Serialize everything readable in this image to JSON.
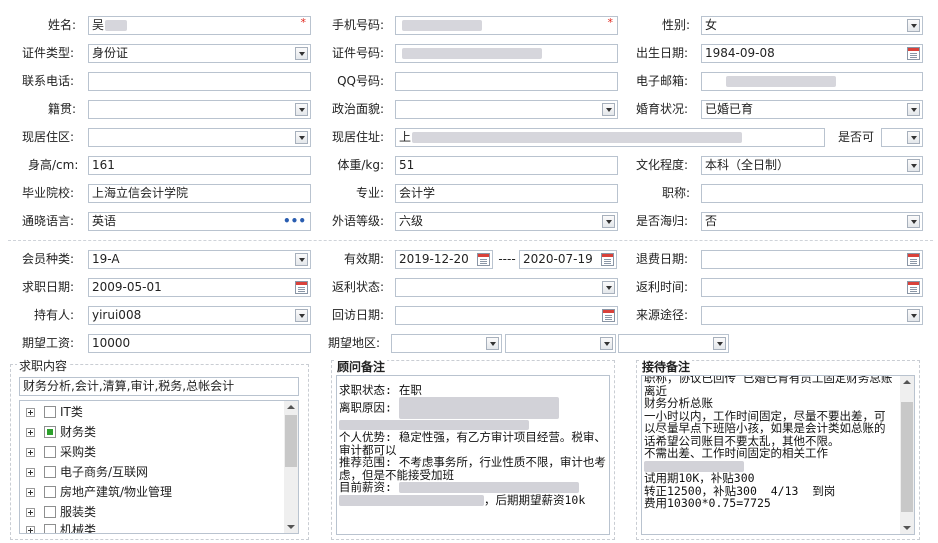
{
  "basic": {
    "name_label": "姓名:",
    "name_value": "吴",
    "required_mark": "*",
    "phone_label": "手机号码:",
    "gender_label": "性别:",
    "gender_value": "女",
    "id_type_label": "证件类型:",
    "id_type_value": "身份证",
    "id_no_label": "证件号码:",
    "birth_label": "出生日期:",
    "birth_value": "1984-09-08",
    "contact_label": "联系电话:",
    "qq_label": "QQ号码:",
    "email_label": "电子邮箱:",
    "native_label": "籍贯:",
    "political_label": "政治面貌:",
    "marital_label": "婚育状况:",
    "marital_value": "已婚已育",
    "district_label": "现居住区:",
    "address_label": "现居住址:",
    "address_value": "上",
    "ok_label": "是否可",
    "height_label": "身高/cm:",
    "height_value": "161",
    "weight_label": "体重/kg:",
    "weight_value": "51",
    "edu_label": "文化程度:",
    "edu_value": "本科（全日制）",
    "school_label": "毕业院校:",
    "school_value": "上海立信会计学院",
    "major_label": "专业:",
    "major_value": "会计学",
    "title_label": "职称:",
    "language_label": "通晓语言:",
    "language_value": "英语",
    "language_more": "•••",
    "foreign_level_label": "外语等级:",
    "foreign_level_value": "六级",
    "overseas_label": "是否海归:",
    "overseas_value": "否"
  },
  "member": {
    "type_label": "会员种类:",
    "type_value": "19-A",
    "valid_label": "有效期:",
    "valid_from": "2019-12-20",
    "valid_sep": "----",
    "valid_to": "2020-07-19",
    "refund_label": "退费日期:",
    "job_date_label": "求职日期:",
    "job_date_value": "2009-05-01",
    "rebate_status_label": "返利状态:",
    "rebate_time_label": "返利时间:",
    "holder_label": "持有人:",
    "holder_value": "yirui008",
    "revisit_label": "回访日期:",
    "source_label": "来源途径:",
    "salary_label": "期望工资:",
    "salary_value": "10000",
    "area_label": "期望地区:"
  },
  "job": {
    "title": "求职内容",
    "summary": "财务分析,会计,清算,审计,税务,总帐会计",
    "tree": [
      {
        "label": "IT类",
        "checked": false
      },
      {
        "label": "财务类",
        "checked": true
      },
      {
        "label": "采购类",
        "checked": false
      },
      {
        "label": "电子商务/互联网",
        "checked": false
      },
      {
        "label": "房地产建筑/物业管理",
        "checked": false
      },
      {
        "label": "服装类",
        "checked": false
      },
      {
        "label": "机械类",
        "checked": false
      }
    ]
  },
  "advisor": {
    "title": "顾问备注",
    "line1": "求职状态: 在职",
    "line2": "离职原因:",
    "line3": "个人优势: 稳定性强，有乙方审计项目经营。税审、审计都可以",
    "line4": "推荐范围: 不考虑事务所，行业性质不限，审计也考虑，但是不能接受加班",
    "line5": "目前薪资:",
    "line6": "，后期期望薪资10k"
  },
  "reception": {
    "title": "接待备注",
    "line1": "职称，协议已回传 已婚已育有员工固定财务总账离近",
    "line2": "财务分析总账",
    "line3": "一小时以内，工作时间固定，尽量不要出差，可以尽量早点下班陪小孩，如果是会计类如总账的话希望公司账目不要太乱，其他不限。",
    "line4": "不需出差、工作时间固定的相关工作",
    "line5": "试用期10K，补贴300",
    "line6": "转正12500，补贴300  4/13  到岗",
    "line7": "费用10300*0.75=7725"
  }
}
